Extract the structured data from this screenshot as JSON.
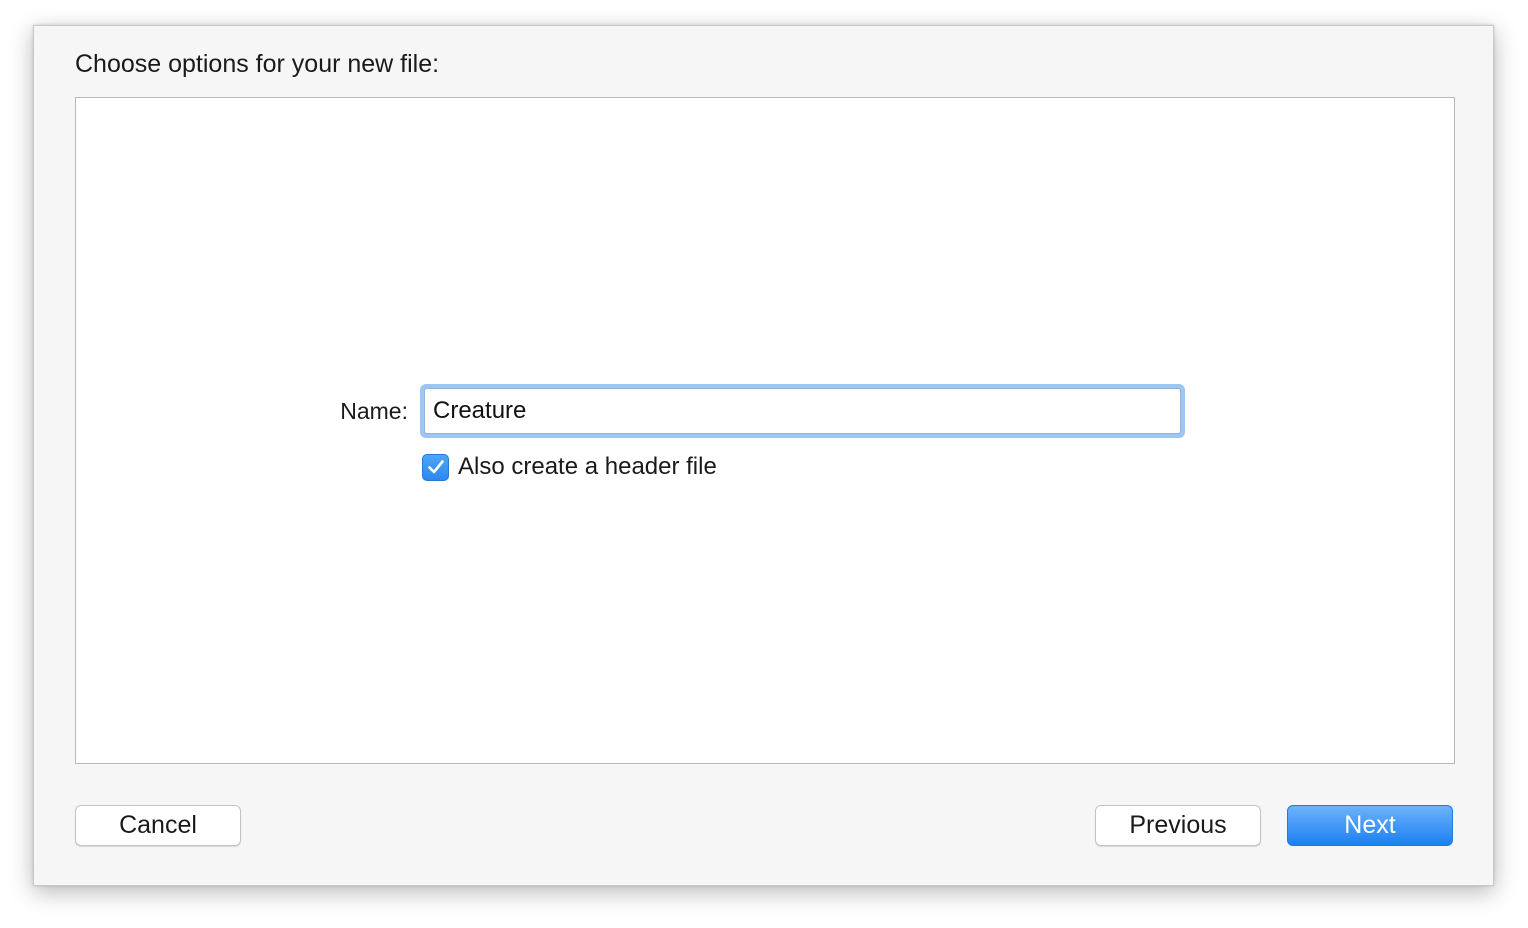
{
  "dialog": {
    "heading": "Choose options for your new file:",
    "name_label": "Name:",
    "name_value": "Creature",
    "header_checkbox": {
      "label": "Also create a header file",
      "checked": true,
      "icon": "checkmark-icon"
    }
  },
  "buttons": {
    "cancel_label": "Cancel",
    "previous_label": "Previous",
    "next_label": "Next"
  },
  "colors": {
    "accent": "#2f86ee",
    "focus_ring": "#9dc6f3",
    "sheet_background": "#f6f6f6"
  }
}
